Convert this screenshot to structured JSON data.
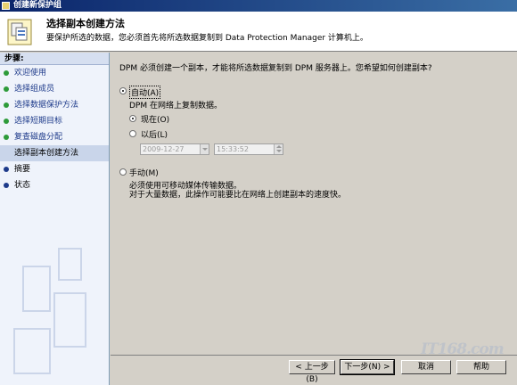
{
  "window": {
    "title": "创建新保护组"
  },
  "header": {
    "title": "选择副本创建方法",
    "subtitle": "要保护所选的数据，您必须首先将所选数据复制到 Data Protection Manager 计算机上。"
  },
  "sidebar": {
    "title": "步骤:",
    "steps": [
      {
        "label": "欢迎使用",
        "state": "done"
      },
      {
        "label": "选择组成员",
        "state": "done"
      },
      {
        "label": "选择数据保护方法",
        "state": "done"
      },
      {
        "label": "选择短期目标",
        "state": "done"
      },
      {
        "label": "复查磁盘分配",
        "state": "done"
      },
      {
        "label": "选择副本创建方法",
        "state": "current"
      },
      {
        "label": "摘要",
        "state": "todo"
      },
      {
        "label": "状态",
        "state": "todo"
      }
    ]
  },
  "main": {
    "question": "DPM 必须创建一个副本，才能将所选数据复制到 DPM 服务器上。您希望如何创建副本?",
    "auto": {
      "label": "自动(A)",
      "desc": "DPM 在网络上复制数据。",
      "now_label": "现在(O)",
      "later_label": "以后(L)",
      "date_value": "2009-12-27",
      "time_value": "15:33:52"
    },
    "manual": {
      "label": "手动(M)",
      "desc1": "必须使用可移动媒体传输数据。",
      "desc2": "对于大量数据，此操作可能要比在网络上创建副本的速度快。"
    }
  },
  "buttons": {
    "back": "< 上一步(B)",
    "next": "下一步(N) >",
    "cancel": "取消",
    "help": "帮助"
  },
  "watermark": "IT168.com"
}
